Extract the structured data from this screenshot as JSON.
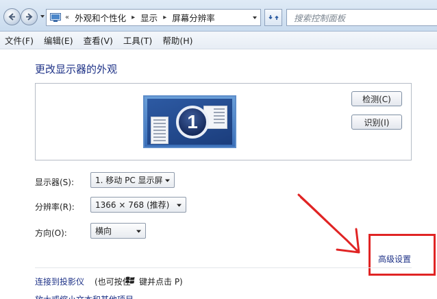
{
  "address_bar": {
    "overflow": "«",
    "breadcrumbs": [
      "外观和个性化",
      "显示",
      "屏幕分辨率"
    ]
  },
  "search": {
    "placeholder": "搜索控制面板"
  },
  "menu": [
    "文件(F)",
    "编辑(E)",
    "查看(V)",
    "工具(T)",
    "帮助(H)"
  ],
  "page": {
    "title": "更改显示器的外观",
    "monitor_number": "1",
    "detect_button": "检测(C)",
    "identify_button": "识别(I)"
  },
  "settings": {
    "display_label": "显示器(S):",
    "display_value": "1. 移动 PC 显示屏",
    "resolution_label": "分辨率(R):",
    "resolution_value": "1366 × 768 (推荐)",
    "orientation_label": "方向(O):",
    "orientation_value": "横向"
  },
  "links": {
    "advanced": "高级设置",
    "projector": "连接到投影仪",
    "projector_hint_prefix": "(也可按住",
    "projector_hint_suffix": "键并点击 P)",
    "text_size": "放大或缩小文本和其他项目"
  },
  "colors": {
    "link": "#1e3287",
    "annotation_red": "#e02424"
  }
}
